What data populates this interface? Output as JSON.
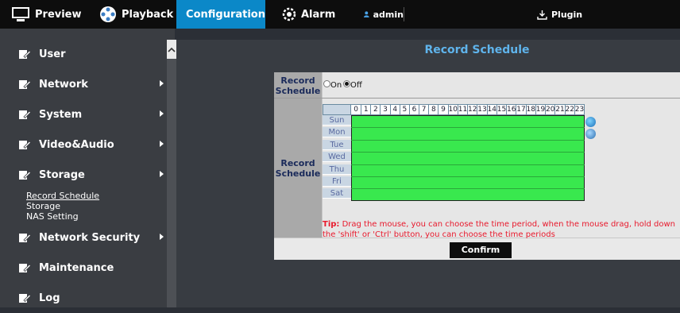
{
  "topbar": {
    "tabs": [
      {
        "label": "Preview"
      },
      {
        "label": "Playback"
      },
      {
        "label": "Configuration"
      },
      {
        "label": "Alarm"
      }
    ],
    "user": "admin",
    "plugin": "Plugin"
  },
  "sidebar": {
    "items": [
      {
        "label": "User"
      },
      {
        "label": "Network"
      },
      {
        "label": "System"
      },
      {
        "label": "Video&Audio"
      },
      {
        "label": "Storage"
      },
      {
        "label": "Network Security"
      },
      {
        "label": "Maintenance"
      },
      {
        "label": "Log"
      }
    ],
    "storage_sub": [
      "Record Schedule",
      "Storage",
      "NAS Setting"
    ]
  },
  "main": {
    "title": "Record Schedule",
    "row1_label_a": "Record",
    "row1_label_b": "Schedule",
    "on_label": "On",
    "off_label": "Off",
    "selected": "Off",
    "row2_label_a": "Record",
    "row2_label_b": "Schedule",
    "hours": [
      "0",
      "1",
      "2",
      "3",
      "4",
      "5",
      "6",
      "7",
      "8",
      "9",
      "10",
      "11",
      "12",
      "13",
      "14",
      "15",
      "16",
      "17",
      "18",
      "19",
      "20",
      "21",
      "22",
      "23"
    ],
    "days": [
      "Sun",
      "Mon",
      "Tue",
      "Wed",
      "Thu",
      "Fri",
      "Sat"
    ],
    "tip_prefix": "Tip:",
    "tip_text": " Drag the mouse, you can choose the time period, when the mouse drag, hold down the 'shift' or 'Ctrl' button, you can choose the time periods",
    "confirm": "Confirm"
  },
  "colors": {
    "accent": "#0b88c8",
    "title": "#5fb4ec",
    "schedule_fill": "#39e84e",
    "tip": "#e8192c"
  }
}
